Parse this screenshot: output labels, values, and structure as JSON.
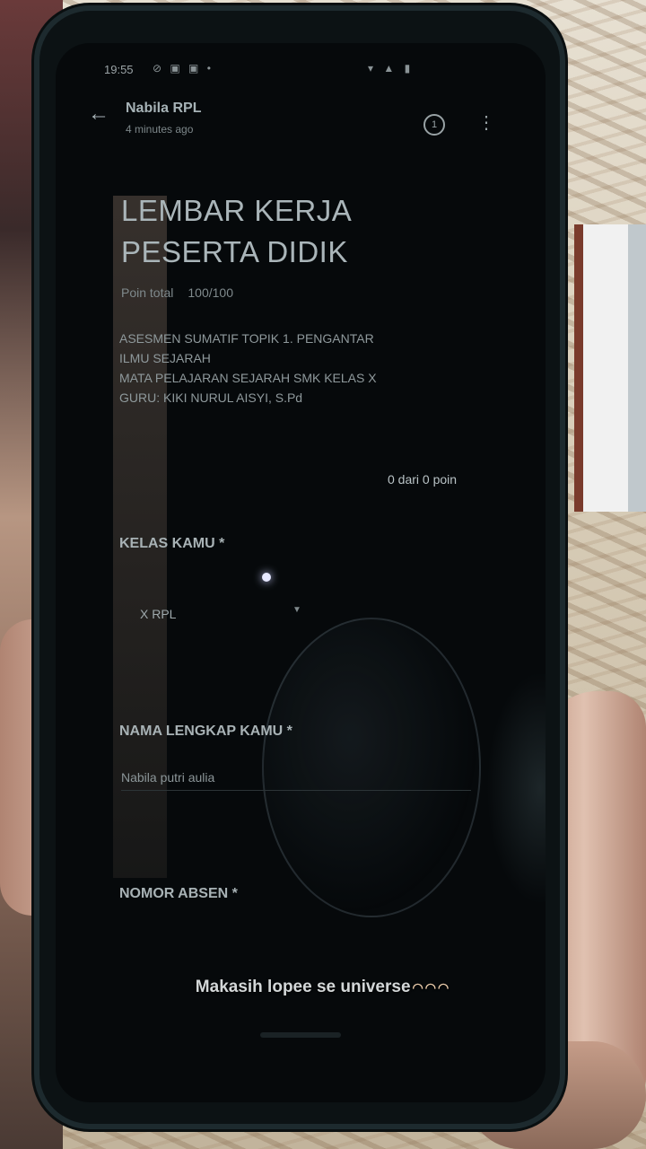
{
  "status_bar": {
    "time": "19:55",
    "left_icons": "⊘ ▣ ▣ •",
    "right_icons": "▾ ▲ ▮"
  },
  "app_bar": {
    "name": "Nabila RPL",
    "subtitle": "4 minutes ago"
  },
  "form": {
    "title_line1": "LEMBAR KERJA",
    "title_line2": "PESERTA DIDIK",
    "points_label": "Poin total",
    "points_value": "100/100",
    "description": [
      "ASESMEN SUMATIF TOPIK 1. PENGANTAR",
      "ILMU SEJARAH",
      "MATA PELAJARAN SEJARAH SMK KELAS X",
      "GURU: KIKI NURUL AISYI, S.Pd"
    ],
    "score": "0 dari 0 poin",
    "questions": [
      {
        "label": "KELAS KAMU *",
        "answer": "X RPL"
      },
      {
        "label": "NAMA LENGKAP KAMU *",
        "answer": "Nabila putri aulia"
      },
      {
        "label": "NOMOR ABSEN *",
        "answer": ""
      }
    ]
  },
  "caption": {
    "text": "Makasih lopee se universe",
    "emoji": "◠◠◠"
  }
}
